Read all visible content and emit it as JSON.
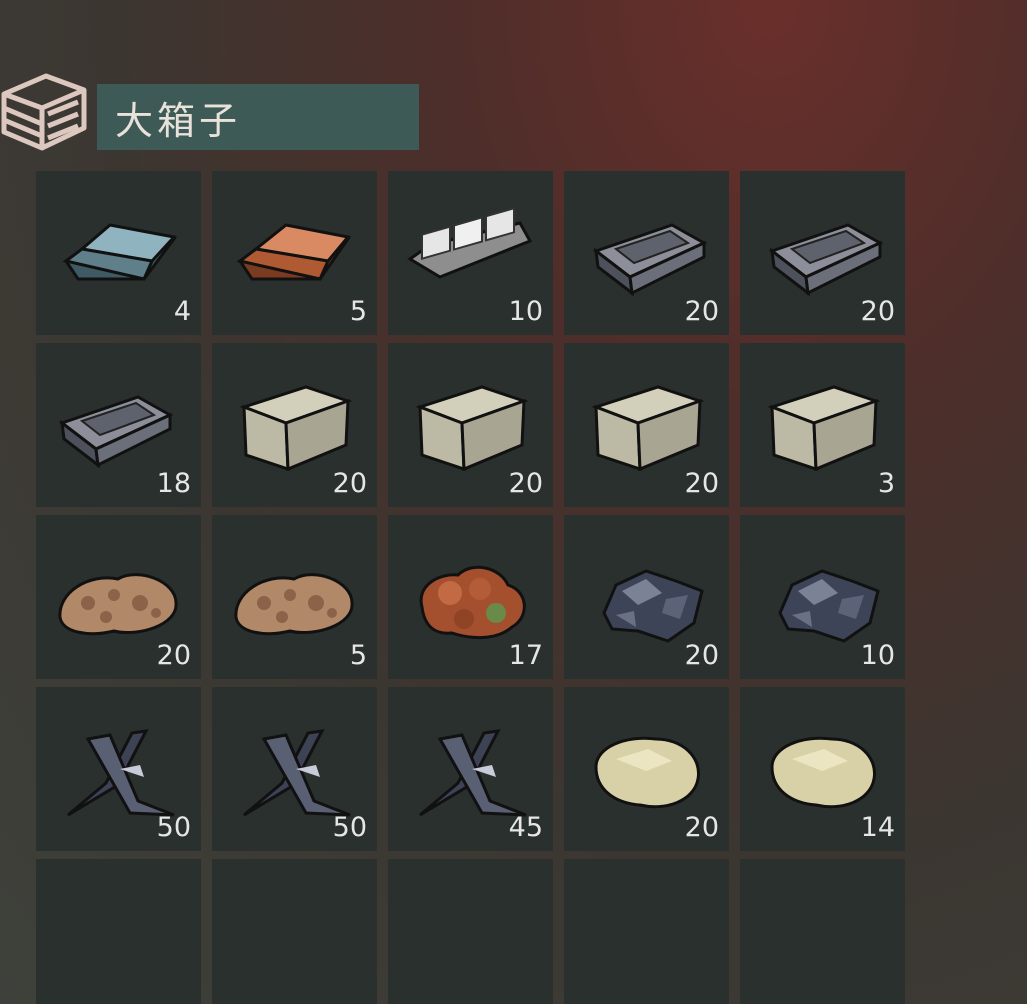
{
  "container": {
    "title": "大箱子",
    "icon": "chest-icon"
  },
  "slots": [
    {
      "item": "iron-ingot-icon",
      "count": "4"
    },
    {
      "item": "copper-ingot-icon",
      "count": "5"
    },
    {
      "item": "aluminum-bar-icon",
      "count": "10"
    },
    {
      "item": "steel-ingot-icon",
      "count": "20"
    },
    {
      "item": "steel-ingot-icon",
      "count": "20"
    },
    {
      "item": "steel-ingot-icon",
      "count": "18"
    },
    {
      "item": "stone-block-icon",
      "count": "20"
    },
    {
      "item": "stone-block-icon",
      "count": "20"
    },
    {
      "item": "stone-block-icon",
      "count": "20"
    },
    {
      "item": "stone-block-icon",
      "count": "3"
    },
    {
      "item": "iron-ore-icon",
      "count": "20"
    },
    {
      "item": "iron-ore-icon",
      "count": "5"
    },
    {
      "item": "copper-ore-icon",
      "count": "17"
    },
    {
      "item": "coal-ore-icon",
      "count": "20"
    },
    {
      "item": "coal-ore-icon",
      "count": "10"
    },
    {
      "item": "metal-scrap-icon",
      "count": "50"
    },
    {
      "item": "metal-scrap-icon",
      "count": "50"
    },
    {
      "item": "metal-scrap-icon",
      "count": "45"
    },
    {
      "item": "limestone-icon",
      "count": "20"
    },
    {
      "item": "limestone-icon",
      "count": "14"
    },
    {
      "item": "",
      "count": ""
    },
    {
      "item": "",
      "count": ""
    },
    {
      "item": "",
      "count": ""
    },
    {
      "item": "",
      "count": ""
    },
    {
      "item": "",
      "count": ""
    }
  ]
}
